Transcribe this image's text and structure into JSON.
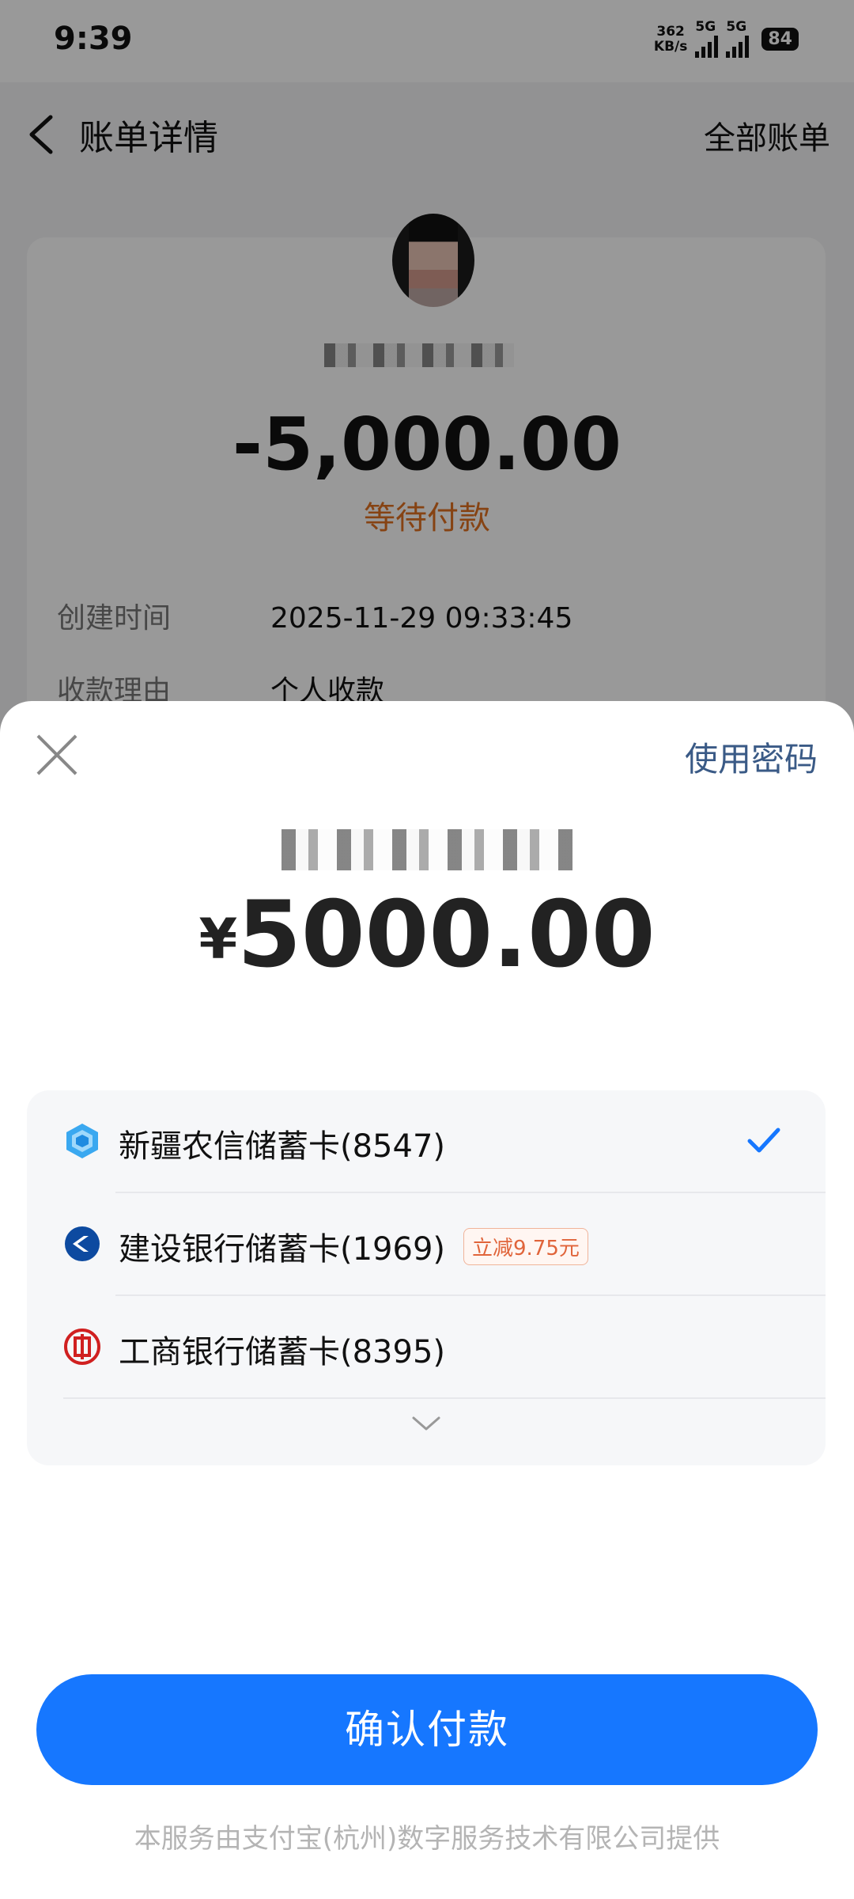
{
  "status_bar": {
    "time": "9:39",
    "net_speed_value": "362",
    "net_speed_unit": "KB/s",
    "sim1": "5G",
    "sim2": "5G",
    "battery": "84"
  },
  "nav": {
    "title": "账单详情",
    "right": "全部账单",
    "back_icon": "chevron-left-icon"
  },
  "bill": {
    "amount": "-5,000.00",
    "status": "等待付款",
    "status_color": "#e07020",
    "rows": [
      {
        "label": "创建时间",
        "value": "2025-11-29 09:33:45"
      },
      {
        "label": "收款理由",
        "value": "个人收款"
      }
    ]
  },
  "sheet": {
    "close_icon": "close-icon",
    "use_password": "使用密码",
    "currency": "¥",
    "amount": "5000.00",
    "cards": [
      {
        "icon": "xinjiang-rcc-icon",
        "label": "新疆农信储蓄卡(8547)",
        "selected": true
      },
      {
        "icon": "ccb-icon",
        "label": "建设银行储蓄卡(1969)",
        "promo": "立减9.75元"
      },
      {
        "icon": "icbc-icon",
        "label": "工商银行储蓄卡(8395)"
      }
    ],
    "expand_icon": "chevron-down-icon",
    "confirm": "确认付款",
    "footer": "本服务由支付宝(杭州)数字服务技术有限公司提供",
    "accent_color": "#1677ff"
  }
}
